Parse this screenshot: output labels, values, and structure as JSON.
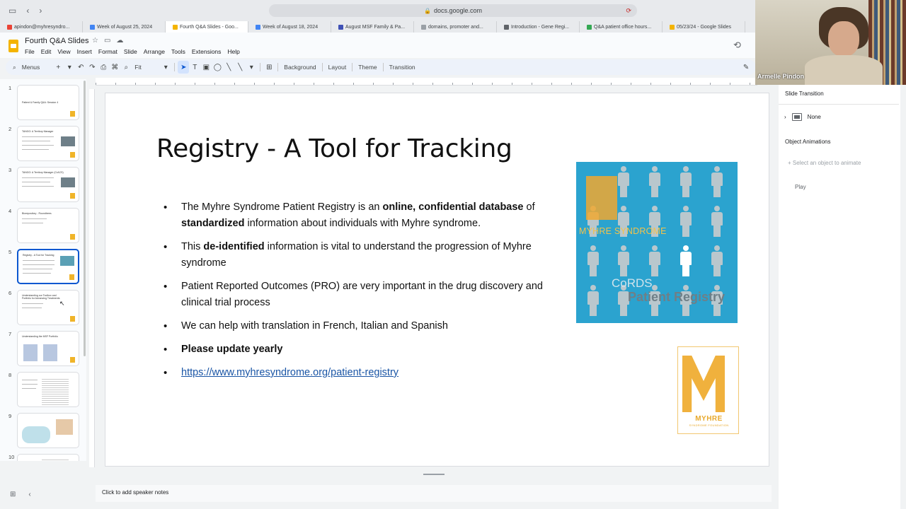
{
  "browser": {
    "url": "docs.google.com",
    "tabs": [
      {
        "label": "apindon@myhresyndro..."
      },
      {
        "label": "Week of August 25, 2024"
      },
      {
        "label": "Fourth Q&A Slides - Goo..."
      },
      {
        "label": "Week of August 18, 2024"
      },
      {
        "label": "August MSF Family & Pa..."
      },
      {
        "label": "domains, promoter and..."
      },
      {
        "label": "Introduction - Gene Regi..."
      },
      {
        "label": "Q&A patient office hours..."
      },
      {
        "label": "05/23/24 - Google Slides"
      }
    ]
  },
  "app": {
    "doc_title": "Fourth Q&A Slides",
    "menus": [
      "File",
      "Edit",
      "View",
      "Insert",
      "Format",
      "Slide",
      "Arrange",
      "Tools",
      "Extensions",
      "Help"
    ]
  },
  "toolbar": {
    "menus_label": "Menus",
    "zoom_label": "Fit",
    "background_label": "Background",
    "layout_label": "Layout",
    "theme_label": "Theme",
    "transition_label": "Transition"
  },
  "filmstrip": {
    "slides": [
      {
        "num": "1",
        "title": "Patient & Family Q&A: Session 4"
      },
      {
        "num": "2",
        "title": "TANGO: A Territory Manager"
      },
      {
        "num": "3",
        "title": "TANGO: A Territory Manager (CrACS)"
      },
      {
        "num": "4",
        "title": "Biorepository - Roundtrees"
      },
      {
        "num": "5",
        "title": "Registry - A Tool for Tracking"
      },
      {
        "num": "6",
        "title": "Understanding our Toolbox and Portfolio for Advancing Treatments"
      },
      {
        "num": "7",
        "title": "Understanding the MSF Portfolio"
      },
      {
        "num": "8",
        "title": ""
      },
      {
        "num": "9",
        "title": ""
      },
      {
        "num": "10",
        "title": ""
      }
    ]
  },
  "slide": {
    "title": "Registry - A Tool for Tracking",
    "b1_pre": "The Myhre Syndrome Patient Registry is an ",
    "b1_bold1": "online, confidential database",
    "b1_mid": " of ",
    "b1_bold2": "standardized",
    "b1_post": " information about individuals with Myhre syndrome.",
    "b2_pre": "This ",
    "b2_bold": "de-identified",
    "b2_post": " information is vital to understand the progression of Myhre syndrome",
    "b3": "Patient Reported Outcomes (PRO) are very important in the drug discovery and clinical trial process",
    "b4": "We can help with translation in French, Italian and Spanish",
    "b5": "Please update yearly",
    "b6_link": "https://www.myhresyndrome.org/patient-registry",
    "registry_image": {
      "brand": "MYHRE SYNDROME",
      "cords": "CoRDS",
      "label": "Patient Registry"
    },
    "foundation_logo": {
      "name": "MYHRE",
      "sub": "SYNDROME FOUNDATION"
    }
  },
  "right_panel": {
    "slide_transition": "Slide Transition",
    "transition_value": "None",
    "object_animations": "Object Animations",
    "add_placeholder": "+ Select an object to animate",
    "play_label": "Play"
  },
  "video": {
    "participant_name": "Armelle Pindon"
  },
  "notes": {
    "placeholder": "Click to add speaker notes"
  },
  "colors": {
    "accent": "#0b57d0",
    "registry_blue": "#2ba3cf",
    "brand_yellow": "#f0b13d",
    "link": "#1a55a5"
  }
}
